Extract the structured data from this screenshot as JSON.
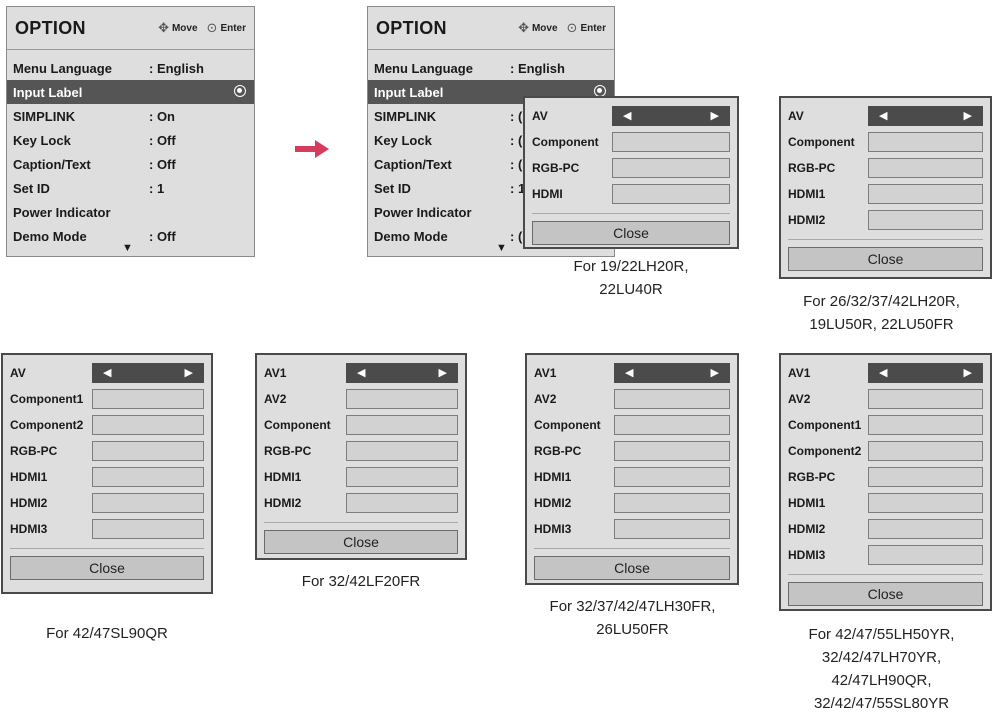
{
  "option_menu": {
    "title": "OPTION",
    "hint_move": "Move",
    "hint_enter": "Enter",
    "rows": [
      {
        "label": "Menu Language",
        "value": ": English"
      },
      {
        "label": "Input Label",
        "value": ""
      },
      {
        "label": "SIMPLINK",
        "value": ": On"
      },
      {
        "label": "Key Lock",
        "value": ": Off"
      },
      {
        "label": "Caption/Text",
        "value": ": Off"
      },
      {
        "label": "Set ID",
        "value": ": 1"
      },
      {
        "label": "Power Indicator",
        "value": ""
      },
      {
        "label": "Demo Mode",
        "value": ": Off"
      }
    ],
    "partial_values": [
      ": English",
      "",
      ": (",
      ": (",
      ": (",
      ": 1",
      "",
      ": ("
    ]
  },
  "close_label": "Close",
  "dialogs": {
    "d1": {
      "rows": [
        "AV",
        "Component",
        "RGB-PC",
        "HDMI"
      ],
      "caption": [
        "For 19/22LH20R,",
        "22LU40R"
      ]
    },
    "d2": {
      "rows": [
        "AV",
        "Component",
        "RGB-PC",
        "HDMI1",
        "HDMI2"
      ],
      "caption": [
        "For 26/32/37/42LH20R,",
        "19LU50R, 22LU50FR"
      ]
    },
    "d3": {
      "rows": [
        "AV",
        "Component1",
        "Component2",
        "RGB-PC",
        "HDMI1",
        "HDMI2",
        "HDMI3"
      ],
      "caption": [
        "For 42/47SL90QR"
      ]
    },
    "d4": {
      "rows": [
        "AV1",
        "AV2",
        "Component",
        "RGB-PC",
        "HDMI1",
        "HDMI2"
      ],
      "caption": [
        "For 32/42LF20FR"
      ]
    },
    "d5": {
      "rows": [
        "AV1",
        "AV2",
        "Component",
        "RGB-PC",
        "HDMI1",
        "HDMI2",
        "HDMI3"
      ],
      "caption": [
        "For 32/37/42/47LH30FR,",
        "26LU50FR"
      ]
    },
    "d6": {
      "rows": [
        "AV1",
        "AV2",
        "Component1",
        "Component2",
        "RGB-PC",
        "HDMI1",
        "HDMI2",
        "HDMI3"
      ],
      "caption": [
        "For 42/47/55LH50YR,",
        "32/42/47LH70YR,",
        "42/47LH90QR,",
        "32/42/47/55SL80YR"
      ]
    }
  },
  "colors": {
    "panel": "#dedede",
    "selected": "#555555",
    "arrow": "#d63a5c"
  },
  "icons": {
    "nav": "dpad-move-icon",
    "enter": "enter-icon",
    "more": "down-triangle-icon",
    "selected": "radio-selected-icon",
    "left": "left-arrow-icon",
    "right": "right-arrow-icon"
  }
}
